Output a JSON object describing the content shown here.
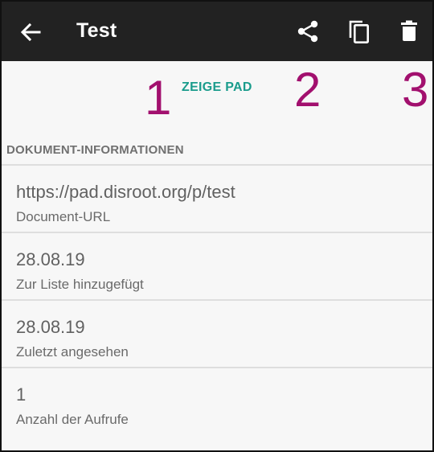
{
  "appbar": {
    "title": "Test",
    "back_icon": "arrow-back-icon",
    "actions": [
      {
        "icon": "share-icon"
      },
      {
        "icon": "copy-icon"
      },
      {
        "icon": "delete-icon"
      }
    ]
  },
  "annotations": {
    "marker1": "1",
    "marker2": "2",
    "marker3": "3"
  },
  "show_pad_label": "ZEIGE PAD",
  "section_header": "DOKUMENT-INFORMATIONEN",
  "info_rows": [
    {
      "value": "https://pad.disroot.org/p/test",
      "label": "Document-URL"
    },
    {
      "value": "28.08.19",
      "label": "Zur Liste hinzugefügt"
    },
    {
      "value": "28.08.19",
      "label": "Zuletzt angesehen"
    },
    {
      "value": "1",
      "label": "Anzahl der Aufrufe"
    }
  ],
  "colors": {
    "appbar": "#222222",
    "accent": "#1a9c8c",
    "marker": "#a2106e",
    "divider": "#dedede"
  }
}
